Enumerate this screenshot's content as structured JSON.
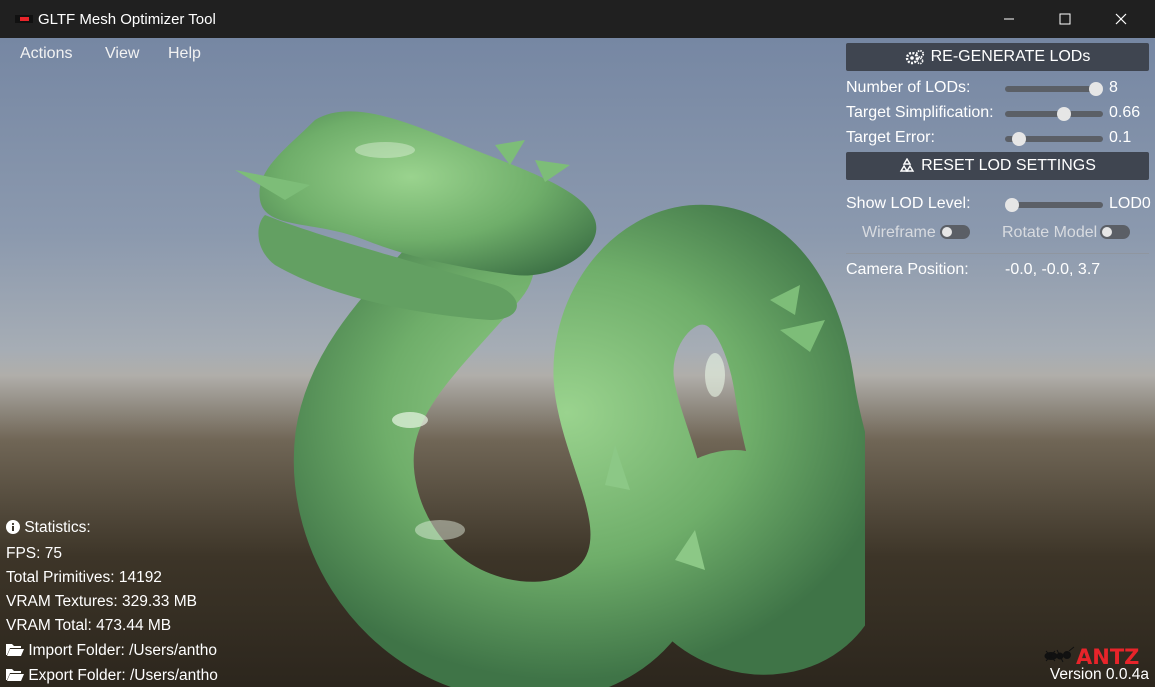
{
  "window": {
    "title": "GLTF Mesh Optimizer Tool",
    "minimize_icon": "minimize-icon",
    "maximize_icon": "maximize-icon",
    "close_icon": "close-icon"
  },
  "menu": {
    "items": [
      {
        "label": "Actions"
      },
      {
        "label": "View"
      },
      {
        "label": "Help"
      }
    ]
  },
  "panel": {
    "regenerate_label": "RE-GENERATE LODs",
    "regenerate_icon": "gears-icon",
    "num_lods": {
      "label": "Number of LODs:",
      "value": "8",
      "fraction": 0.93
    },
    "target_simplification": {
      "label": "Target Simplification:",
      "value": "0.66",
      "fraction": 0.6
    },
    "target_error": {
      "label": "Target Error:",
      "value": "0.1",
      "fraction": 0.14
    },
    "reset_label": "RESET LOD SETTINGS",
    "reset_icon": "recycle-icon",
    "show_lod": {
      "label": "Show LOD Level:",
      "value": "LOD0",
      "fraction": 0.0
    },
    "wireframe": {
      "label": "Wireframe",
      "on": false
    },
    "rotate_model": {
      "label": "Rotate Model",
      "on": false
    },
    "camera": {
      "label": "Camera Position:",
      "value": "-0.0, -0.0, 3.7"
    }
  },
  "stats": {
    "header": "Statistics:",
    "header_icon": "info-icon",
    "fps": "FPS: 75",
    "primitives": "Total Primitives: 14192",
    "vram_textures": "VRAM Textures: 329.33 MB",
    "vram_total": "VRAM Total: 473.44 MB",
    "import_folder": "Import Folder: /Users/antho",
    "export_folder": "Export Folder: /Users/antho",
    "folder_icon": "folder-open-icon"
  },
  "brand": {
    "logo": "ANTZ",
    "version": "Version 0.0.4a"
  },
  "colors": {
    "accent_red": "#e8242a",
    "button_bg": "#3f4550",
    "dragon_green": "#6fae6a"
  }
}
